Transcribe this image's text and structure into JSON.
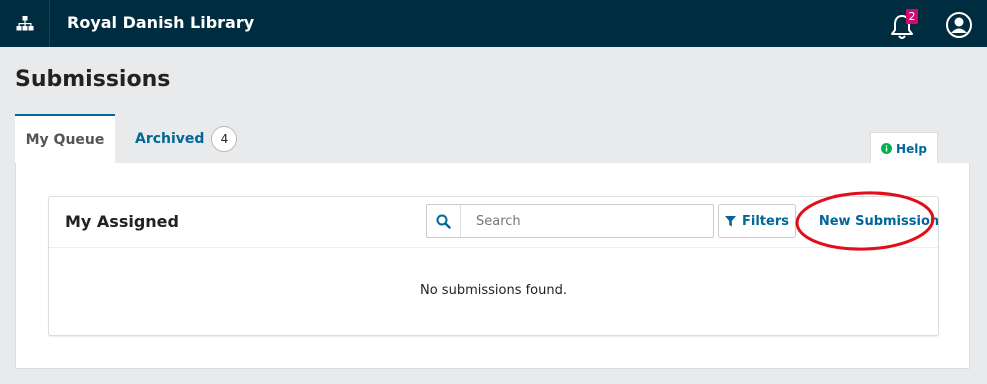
{
  "header": {
    "site_title": "Royal Danish Library",
    "notifications_count": "2",
    "icons": {
      "sitemap": "sitemap-icon",
      "notifications": "bell-icon",
      "user": "user-icon"
    }
  },
  "page": {
    "title": "Submissions"
  },
  "tabs": [
    {
      "label": "My Queue",
      "active": true
    },
    {
      "label": "Archived",
      "count": "4",
      "active": false
    }
  ],
  "help": {
    "label": "Help"
  },
  "submissions_list": {
    "title": "My Assigned",
    "search": {
      "placeholder": "Search",
      "value": ""
    },
    "filters_label": "Filters",
    "new_submission_label": "New Submission",
    "empty_message": "No submissions found."
  },
  "colors": {
    "header_bg": "#002c40",
    "accent": "#006798",
    "badge": "#d00a6c",
    "annotation": "#e0101a"
  }
}
